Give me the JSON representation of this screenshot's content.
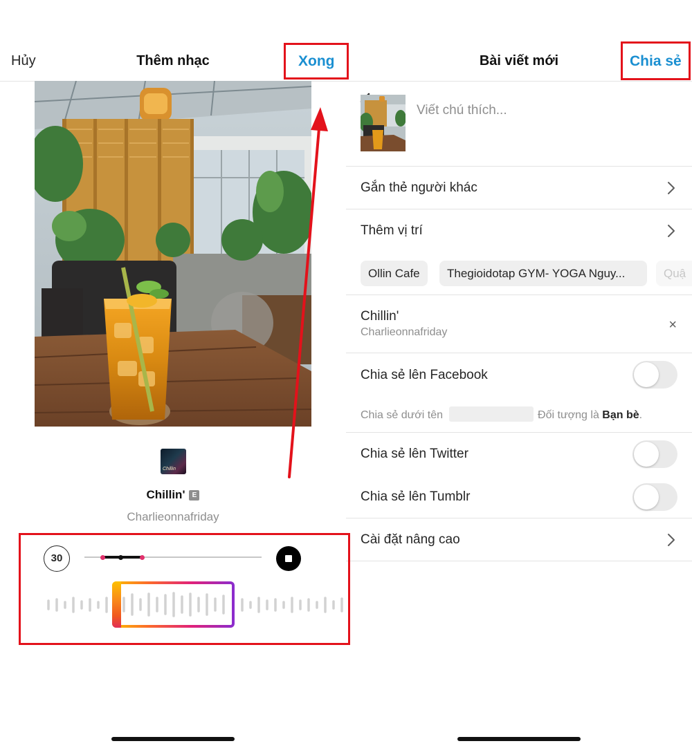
{
  "left": {
    "header": {
      "cancel_label": "Hủy",
      "title": "Thêm nhạc",
      "done_label": "Xong"
    },
    "track": {
      "title": "Chillin'",
      "explicit_badge": "E",
      "artist": "Charlieonnafriday",
      "album_art_text": "Chillin"
    },
    "player": {
      "clip_length": "30"
    }
  },
  "right": {
    "header": {
      "title": "Bài viết mới",
      "share_label": "Chia sẻ"
    },
    "caption_placeholder": "Viết chú thích...",
    "rows": {
      "tag_people": "Gắn thẻ người khác",
      "add_location": "Thêm vị trí"
    },
    "location_chips": [
      "Ollin Cafe",
      "Thegioidotap GYM- YOGA Nguy...",
      "Quậ"
    ],
    "music": {
      "title": "Chillin'",
      "artist": "Charlieonnafriday",
      "remove_icon": "×"
    },
    "share_facebook": {
      "label": "Chia sẻ lên Facebook",
      "enabled": false,
      "sub_prefix": "Chia sẻ dưới tên",
      "sub_audience": "Đối tượng là",
      "sub_audience_value": "Bạn bè",
      "sub_end": "."
    },
    "share_twitter": {
      "label": "Chia sẻ lên Twitter",
      "enabled": false
    },
    "share_tumblr": {
      "label": "Chia sẻ lên Tumblr",
      "enabled": false
    },
    "advanced_settings": "Cài đặt nâng cao"
  },
  "colors": {
    "accent_blue": "#1a8fd1",
    "annotation_red": "#e3121b",
    "gradient_start": "#fdc000",
    "gradient_end": "#8a2ccf"
  },
  "icons": [
    "back-chevron-icon",
    "chevron-right-icon",
    "close-icon",
    "stop-icon",
    "explicit-icon",
    "arrow-annotation"
  ]
}
